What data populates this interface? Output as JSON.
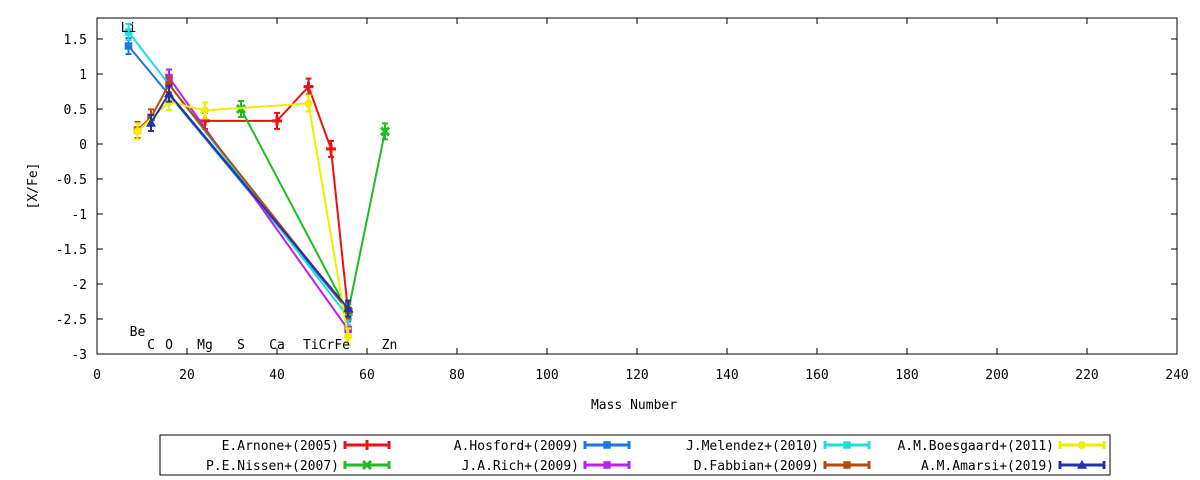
{
  "chart_data": {
    "type": "line",
    "title": "",
    "xlabel": "Mass Number",
    "ylabel": "[X/Fe]",
    "xlim": [
      0,
      240
    ],
    "ylim": [
      -3,
      1.8
    ],
    "xticks": [
      0,
      20,
      40,
      60,
      80,
      100,
      120,
      140,
      160,
      180,
      200,
      220,
      240
    ],
    "yticks": [
      -3,
      -2.5,
      -2,
      -1.5,
      -1,
      -0.5,
      0,
      0.5,
      1,
      1.5
    ],
    "xtick_labels": [
      "0",
      "20",
      "40",
      "60",
      "80",
      "100",
      "120",
      "140",
      "160",
      "180",
      "200",
      "220",
      "240"
    ],
    "ytick_labels": [
      "-3",
      "-2.5",
      "-2",
      "-1.5",
      "-1",
      "-0.5",
      "0",
      "0.5",
      "1",
      "1.5"
    ],
    "grid": false,
    "legend_position": "bottom",
    "element_labels": [
      {
        "text": "Li",
        "x": 7,
        "y": 1.67
      },
      {
        "text": "Be",
        "x": 9,
        "y": -2.67
      },
      {
        "text": "C",
        "x": 12,
        "y": -2.86
      },
      {
        "text": "O",
        "x": 16,
        "y": -2.86
      },
      {
        "text": "Mg",
        "x": 24,
        "y": -2.86
      },
      {
        "text": "S",
        "x": 32,
        "y": -2.86
      },
      {
        "text": "Ca",
        "x": 40,
        "y": -2.86
      },
      {
        "text": "TiCrFe",
        "x": 51,
        "y": -2.86
      },
      {
        "text": "Zn",
        "x": 65,
        "y": -2.86
      }
    ],
    "series": [
      {
        "name": "E.Arnone+(2005)",
        "color": "#ee1111",
        "marker": "plus",
        "x": [
          24,
          40,
          47,
          52,
          55.8
        ],
        "y": [
          0.33,
          0.33,
          0.82,
          -0.07,
          -2.4
        ]
      },
      {
        "name": "P.E.Nissen+(2007)",
        "color": "#22bb22",
        "marker": "cross",
        "x": [
          32,
          55.8,
          64
        ],
        "y": [
          0.5,
          -2.4,
          0.18
        ]
      },
      {
        "name": "A.Hosford+(2009)",
        "color": "#1a78e0",
        "marker": "square",
        "x": [
          7,
          55.8
        ],
        "y": [
          1.4,
          -2.38
        ]
      },
      {
        "name": "J.A.Rich+(2009)",
        "color": "#bb22ee",
        "marker": "square",
        "x": [
          16,
          55.8
        ],
        "y": [
          0.95,
          -2.65
        ]
      },
      {
        "name": "J.Melendez+(2010)",
        "color": "#22dddd",
        "marker": "square",
        "x": [
          7,
          55.8
        ],
        "y": [
          1.6,
          -2.47
        ]
      },
      {
        "name": "D.Fabbian+(2009)",
        "color": "#b84a0a",
        "marker": "square",
        "x": [
          9,
          12,
          16,
          55.8
        ],
        "y": [
          0.2,
          0.38,
          0.85,
          -2.38
        ]
      },
      {
        "name": "A.M.Boesgaard+(2011)",
        "color": "#eeee00",
        "marker": "circle",
        "x": [
          9,
          16,
          24,
          47,
          55.8
        ],
        "y": [
          0.18,
          0.6,
          0.48,
          0.58,
          -2.75
        ]
      },
      {
        "name": "A.M.Amarsi+(2019)",
        "color": "#2233aa",
        "marker": "triangle",
        "x": [
          12,
          16,
          55.8
        ],
        "y": [
          0.3,
          0.72,
          -2.35
        ]
      }
    ]
  }
}
